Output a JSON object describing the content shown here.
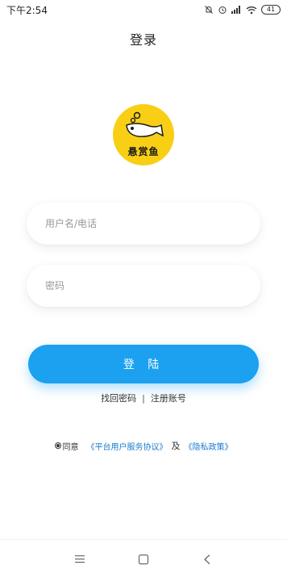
{
  "status_bar": {
    "time": "下午2:54",
    "battery": "41"
  },
  "header": {
    "title": "登录"
  },
  "logo": {
    "text": "悬赏鱼",
    "background_color": "#f8cf15"
  },
  "form": {
    "username_placeholder": "用户名/电话",
    "username_value": "",
    "password_placeholder": "密码",
    "password_value": "",
    "login_label": "登 陆",
    "login_color": "#1ba1f0"
  },
  "links": {
    "forgot_password": "找回密码",
    "separator": "|",
    "register": "注册账号"
  },
  "agreement": {
    "agree_text": "同意",
    "platform_agreement": "《平台用户服务协议》",
    "and_text": "及",
    "privacy_policy": "《隐私政策》",
    "checked": true
  },
  "nav_bar": {
    "icons": [
      "menu-icon",
      "home-square-icon",
      "back-chevron-icon"
    ]
  }
}
